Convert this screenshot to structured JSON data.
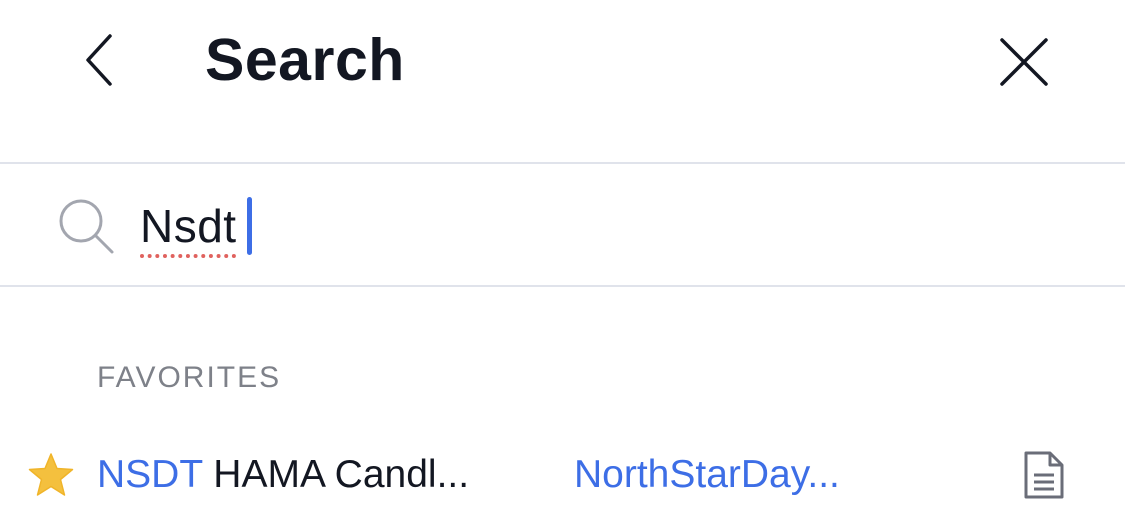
{
  "header": {
    "title": "Search",
    "back_icon": "chevron-left-icon",
    "close_icon": "close-icon"
  },
  "search": {
    "value": "Nsdt",
    "icon": "search-icon",
    "caret_color": "#3d6ee6",
    "spellcheck_underline_color": "#e0625e"
  },
  "favorites": {
    "label": "FAVORITES",
    "items": [
      {
        "ticker": "NSDT",
        "name": " HAMA Candl...",
        "author": "NorthStarDay...",
        "icon_left": "star-icon",
        "icon_right": "document-icon"
      }
    ]
  },
  "colors": {
    "accent": "#3d6ee6",
    "text": "#131722",
    "muted": "#7e8189",
    "divider": "#e0e3eb",
    "star": "#f4c03e"
  }
}
